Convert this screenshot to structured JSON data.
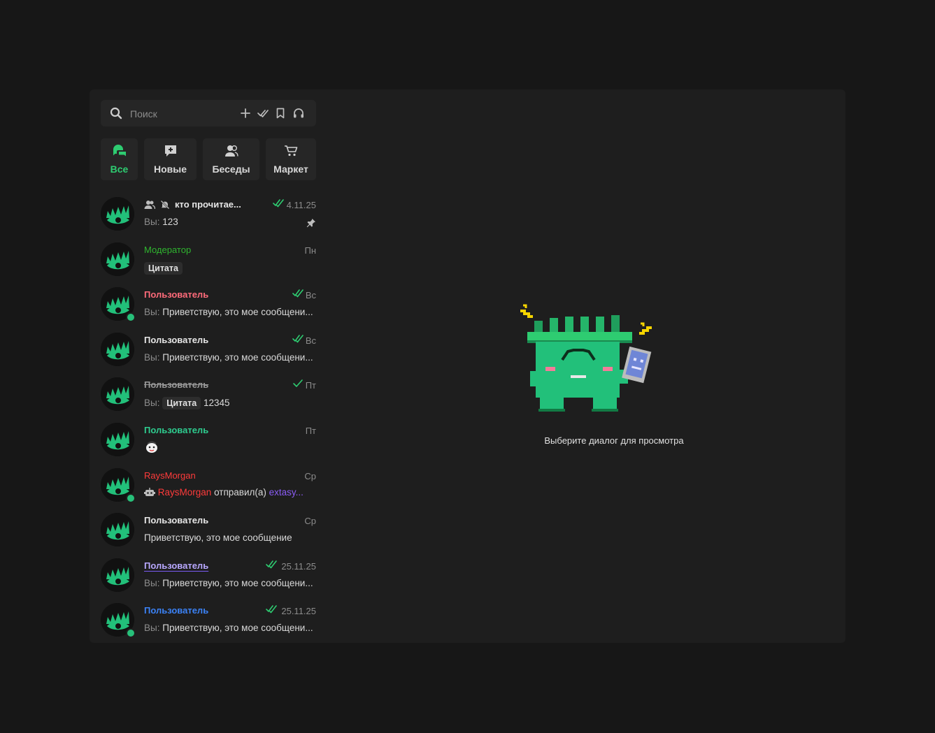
{
  "search": {
    "placeholder": "Поиск"
  },
  "header_actions": [
    "plus-icon",
    "check-all-icon",
    "bookmark-icon",
    "headphones-icon"
  ],
  "tabs": [
    {
      "label": "Все",
      "icon": "chat-bubbles-icon",
      "active": true
    },
    {
      "label": "Новые",
      "icon": "new-message-icon",
      "active": false
    },
    {
      "label": "Беседы",
      "icon": "group-icon",
      "active": false
    },
    {
      "label": "Маркет",
      "icon": "cart-icon",
      "active": false
    }
  ],
  "chats": [
    {
      "name": "кто прочитае...",
      "time": "4.11.25",
      "you": "Вы:",
      "text": "123",
      "group": true,
      "muted": true,
      "pinned": true,
      "read": true,
      "online": false
    },
    {
      "name": "Модератор",
      "time": "Пн",
      "quote": "Цитата"
    },
    {
      "name": "Пользователь",
      "time": "Вс",
      "you": "Вы:",
      "text": "Приветствую, это мое сообщени...",
      "read": true,
      "online": true
    },
    {
      "name": "Пользователь",
      "time": "Вс",
      "you": "Вы:",
      "text": "Приветствую, это мое сообщени...",
      "read": true
    },
    {
      "name": "Пользователь",
      "time": "Пт",
      "you": "Вы:",
      "quote": "Цитата",
      "text": "12345",
      "read": true,
      "strikethrough": true
    },
    {
      "name": "Пользователь",
      "time": "Пт",
      "sticker": true
    },
    {
      "name": "RaysMorgan",
      "time": "Ср",
      "online": true,
      "bot": true,
      "sender": "RaysMorgan",
      "action": "отправил(а)",
      "target": "extasy..."
    },
    {
      "name": "Пользователь",
      "time": "Ср",
      "text": "Приветствую, это мое сообщение"
    },
    {
      "name": "Пользователь",
      "time": "25.11.25",
      "you": "Вы:",
      "text": "Приветствую, это мое сообщени...",
      "read": true
    },
    {
      "name": "Пользователь",
      "time": "25.11.25",
      "you": "Вы:",
      "text": "Приветствую, это мое сообщени...",
      "read": true,
      "online": true
    }
  ],
  "colors": {
    "accent": "#2ecc71",
    "moderator": "#2fb52f",
    "user_pink": "#ff6b7a",
    "user_green": "#2ecc8f",
    "user_red": "#ff3b3b",
    "user_blue": "#3b82f6",
    "mention": "#8b5cf6",
    "online": "#27c07a"
  },
  "empty_state": {
    "text": "Выберите диалог для просмотра",
    "illustration": "green-pixel-mascot"
  }
}
